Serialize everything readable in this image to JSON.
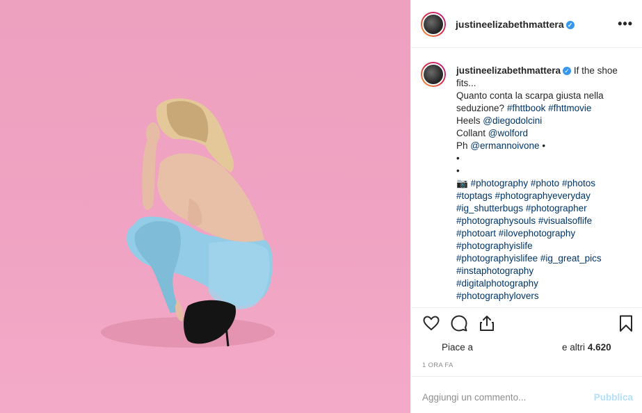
{
  "post": {
    "username": "justineelizabethmattera",
    "verified_icon": "verified-badge-icon",
    "more_icon": "more-options-icon",
    "caption_lines": [
      "If the shoe",
      "fits...",
      "Quanto conta la scarpa giusta nella",
      "seduzione?",
      "#fhttbook #fhttmovie",
      "Heels",
      "@diegodolcini",
      "Collant",
      "@wolford",
      "Ph",
      "@ermannoivone",
      "•",
      "•",
      "•",
      "📷",
      "#photography #photo #photos",
      "#toptags #photographyeveryday",
      "#ig_shutterbugs #photographer",
      "#photographysouls #visualsoflife",
      "#photoart #ilovephotography",
      "#photographyislife",
      "#photographyislifee #ig_great_pics",
      "#instaphotography",
      "#digitalphotography",
      "#photographylovers"
    ],
    "likes_prefix": "Piace a",
    "likes_suffix": "e altri",
    "likes_count": "4.620",
    "time_ago": "1 ORA FA",
    "comment_placeholder": "Aggiungi un commento...",
    "publish_label": "Pubblica"
  },
  "icons": {
    "like": "heart-icon",
    "comment": "comment-icon",
    "share": "share-icon",
    "save": "bookmark-icon"
  },
  "colors": {
    "background_pink": "#f0a3c2",
    "link_blue": "#003569",
    "verified_blue": "#3897f0",
    "publish_disabled": "#b2dffc",
    "muted_text": "#8e8e8e"
  }
}
